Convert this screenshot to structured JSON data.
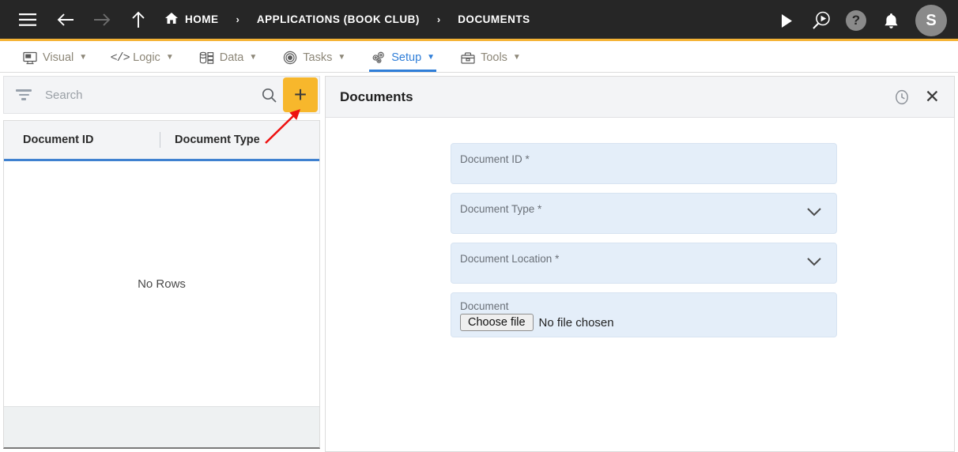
{
  "topbar": {
    "menu_icon": "hamburger-menu-icon",
    "back_icon": "arrow-left-icon",
    "forward_icon": "arrow-right-icon",
    "up_icon": "arrow-up-icon",
    "home_label": "HOME",
    "separator": "›",
    "breadcrumbs": [
      {
        "label": "APPLICATIONS (BOOK CLUB)"
      },
      {
        "label": "DOCUMENTS"
      }
    ],
    "run_icon": "play-icon",
    "preview_icon": "search-play-icon",
    "help_label": "?",
    "notification_icon": "bell-icon",
    "avatar_initial": "S",
    "accent_bar_color": "#f5b335",
    "background_color": "#262626"
  },
  "menubar": {
    "items": [
      {
        "label": "Visual",
        "icon": "monitor-icon",
        "active": false
      },
      {
        "label": "Logic",
        "icon": "code-icon",
        "active": false
      },
      {
        "label": "Data",
        "icon": "database-icon",
        "active": false
      },
      {
        "label": "Tasks",
        "icon": "target-icon",
        "active": false
      },
      {
        "label": "Setup",
        "icon": "gears-icon",
        "active": true
      },
      {
        "label": "Tools",
        "icon": "toolbox-icon",
        "active": false
      }
    ],
    "caret": "▼",
    "active_color": "#2f7ed8",
    "inactive_color": "#8d8778"
  },
  "left_panel": {
    "filter_icon": "filter-icon",
    "search": {
      "value": "",
      "placeholder": "Search"
    },
    "search_icon": "search-icon",
    "add_button": {
      "label": "+",
      "color": "#f7b72c"
    },
    "grid": {
      "columns": [
        "Document ID",
        "Document Type"
      ],
      "rows": [],
      "empty_message": "No Rows",
      "header_underline_color": "#3f81d0"
    }
  },
  "right_panel": {
    "title": "Documents",
    "history_icon": "clock-history-icon",
    "close_icon": "close-icon",
    "close_label": "✕",
    "fields": [
      {
        "label": "Document ID *",
        "type": "text",
        "value": ""
      },
      {
        "label": "Document Type *",
        "type": "select",
        "value": ""
      },
      {
        "label": "Document Location *",
        "type": "select",
        "value": ""
      }
    ],
    "file_field": {
      "label": "Document",
      "button_label": "Choose file",
      "status": "No file chosen"
    },
    "field_background": "#e4eef9"
  },
  "annotation": {
    "arrow_color": "#ee1111",
    "points_to": "add-button"
  }
}
